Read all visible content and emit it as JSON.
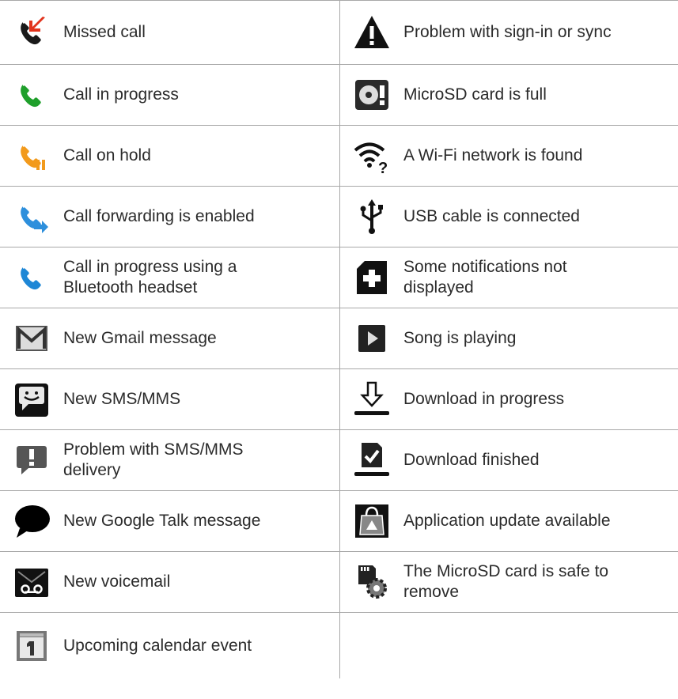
{
  "rows": [
    {
      "left": {
        "icon": "missed-call-icon",
        "label": "Missed call"
      },
      "right": {
        "icon": "warning-icon",
        "label": "Problem with sign-in or sync"
      }
    },
    {
      "left": {
        "icon": "call-in-progress-icon",
        "label": "Call in progress"
      },
      "right": {
        "icon": "microsd-full-icon",
        "label": "MicroSD card is full"
      }
    },
    {
      "left": {
        "icon": "call-on-hold-icon",
        "label": "Call on hold"
      },
      "right": {
        "icon": "wifi-found-icon",
        "label": "A Wi-Fi network is found"
      }
    },
    {
      "left": {
        "icon": "call-forwarding-icon",
        "label": "Call forwarding is enabled"
      },
      "right": {
        "icon": "usb-icon",
        "label": "USB cable is connected"
      }
    },
    {
      "left": {
        "icon": "bluetooth-call-icon",
        "label": "Call in progress using a\nBluetooth headset"
      },
      "right": {
        "icon": "more-notifications-icon",
        "label": "Some notifications not\ndisplayed"
      }
    },
    {
      "left": {
        "icon": "gmail-icon",
        "label": "New Gmail message"
      },
      "right": {
        "icon": "song-playing-icon",
        "label": "Song is playing"
      }
    },
    {
      "left": {
        "icon": "sms-icon",
        "label": "New SMS/MMS"
      },
      "right": {
        "icon": "download-progress-icon",
        "label": "Download in progress"
      }
    },
    {
      "left": {
        "icon": "sms-problem-icon",
        "label": "Problem with SMS/MMS\ndelivery"
      },
      "right": {
        "icon": "download-finished-icon",
        "label": "Download finished"
      }
    },
    {
      "left": {
        "icon": "google-talk-icon",
        "label": "New Google Talk message"
      },
      "right": {
        "icon": "app-update-icon",
        "label": "Application update available"
      }
    },
    {
      "left": {
        "icon": "voicemail-icon",
        "label": "New voicemail"
      },
      "right": {
        "icon": "microsd-safe-remove-icon",
        "label": "The MicroSD card is safe to\nremove"
      }
    },
    {
      "left": {
        "icon": "calendar-icon",
        "label": "Upcoming calendar event"
      },
      "right": null
    }
  ]
}
